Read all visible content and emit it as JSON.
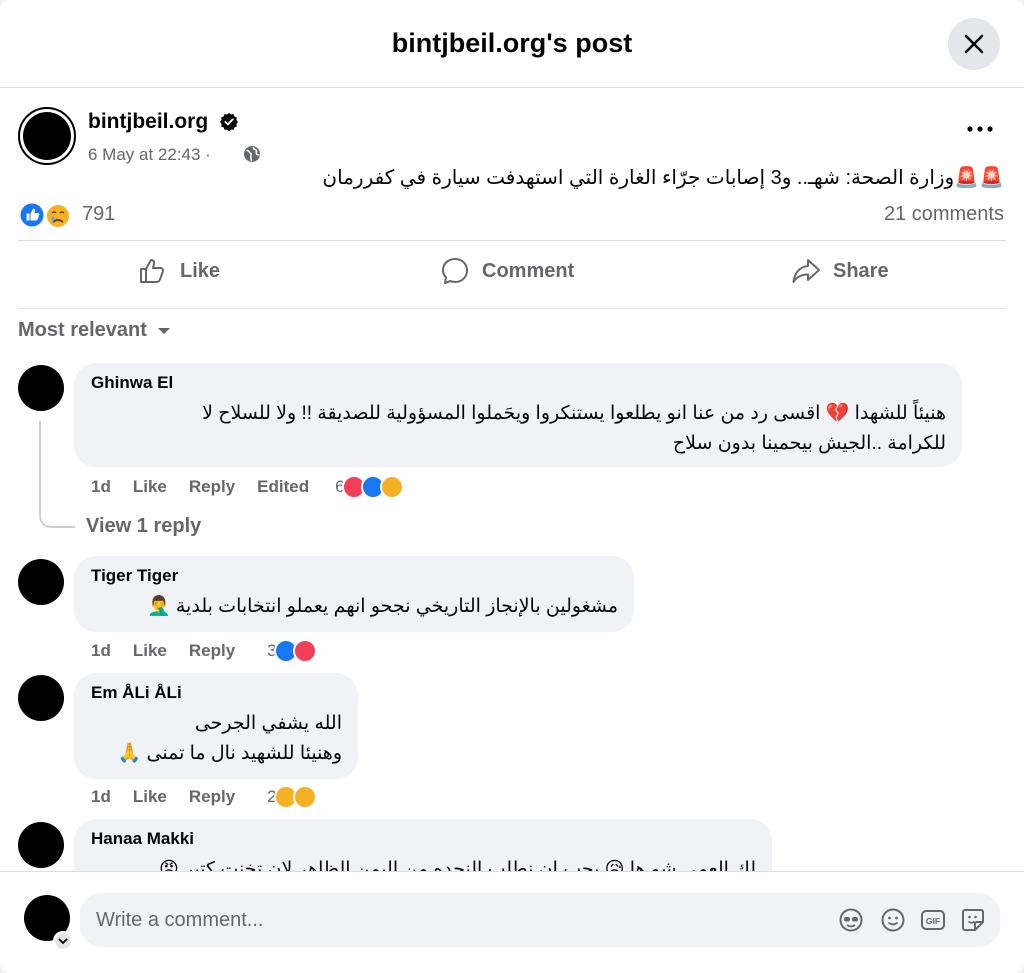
{
  "dialog": {
    "title": "bintjbeil.org's post"
  },
  "post": {
    "author": "bintjbeil.org",
    "date": "6 May at 22:43 ·",
    "text": "🚨🚨وزارة الصحة: شهـ.. و3 إصابات جرّاء الغارة التي استهدفت سيارة في كفررمان",
    "reaction_count": "791",
    "comments_count": "21 comments",
    "reactions": [
      "like",
      "sad"
    ]
  },
  "actions": {
    "like": "Like",
    "comment": "Comment",
    "share": "Share"
  },
  "sort": {
    "label": "Most relevant"
  },
  "comments": [
    {
      "name": "Ghinwa El",
      "lines": [
        "هنيئاً للشهدا 💔 اقسى رد من عنا انو يطلعوا يستنكروا ويحَملوا المسؤولية للصديقة !! ولا للسلاح لا",
        "للكرامة ..الجيش بيحمينا بدون سلاح"
      ],
      "time": "1d",
      "like": "Like",
      "reply": "Reply",
      "edited": "Edited",
      "reaction_count": "6",
      "reactions": [
        "love",
        "like",
        "care"
      ],
      "view_replies": "View 1 reply"
    },
    {
      "name": "Tiger Tiger",
      "lines": [
        "مشغولين بالإنجاز التاريخي نجحو انهم يعملو انتخابات بلدية 🤦‍♂️"
      ],
      "time": "1d",
      "like": "Like",
      "reply": "Reply",
      "reaction_count": "3",
      "reactions": [
        "like",
        "love"
      ]
    },
    {
      "name": "Em ÅLi ÅLi",
      "lines": [
        "الله يشفي الجرحى",
        "وهنيئا للشهيد نال ما تمنى 🙏"
      ],
      "time": "1d",
      "like": "Like",
      "reply": "Reply",
      "reaction_count": "2",
      "reactions": [
        "care",
        "sad"
      ]
    },
    {
      "name": "Hanaa Makki",
      "lines": [
        "لك العمى شو ها 😥 بحب ان نطلب النجده من اليمن الظاهر لان تخنت كتير 😡"
      ]
    }
  ],
  "composer": {
    "placeholder": "Write a comment..."
  },
  "colors": {
    "like_blue": "#1877f2",
    "love_red": "#f33e58",
    "care_yellow": "#f7b125",
    "text_secondary": "#65676b",
    "bubble": "#f0f2f5"
  },
  "icons": [
    "close-icon",
    "verified-icon",
    "globe-icon",
    "more-icon",
    "like-icon",
    "comment-icon",
    "share-icon",
    "chevron-down-icon",
    "avatar-icon",
    "sticker-icon",
    "emoji-icon",
    "gif-icon",
    "sticker-smile-icon"
  ]
}
